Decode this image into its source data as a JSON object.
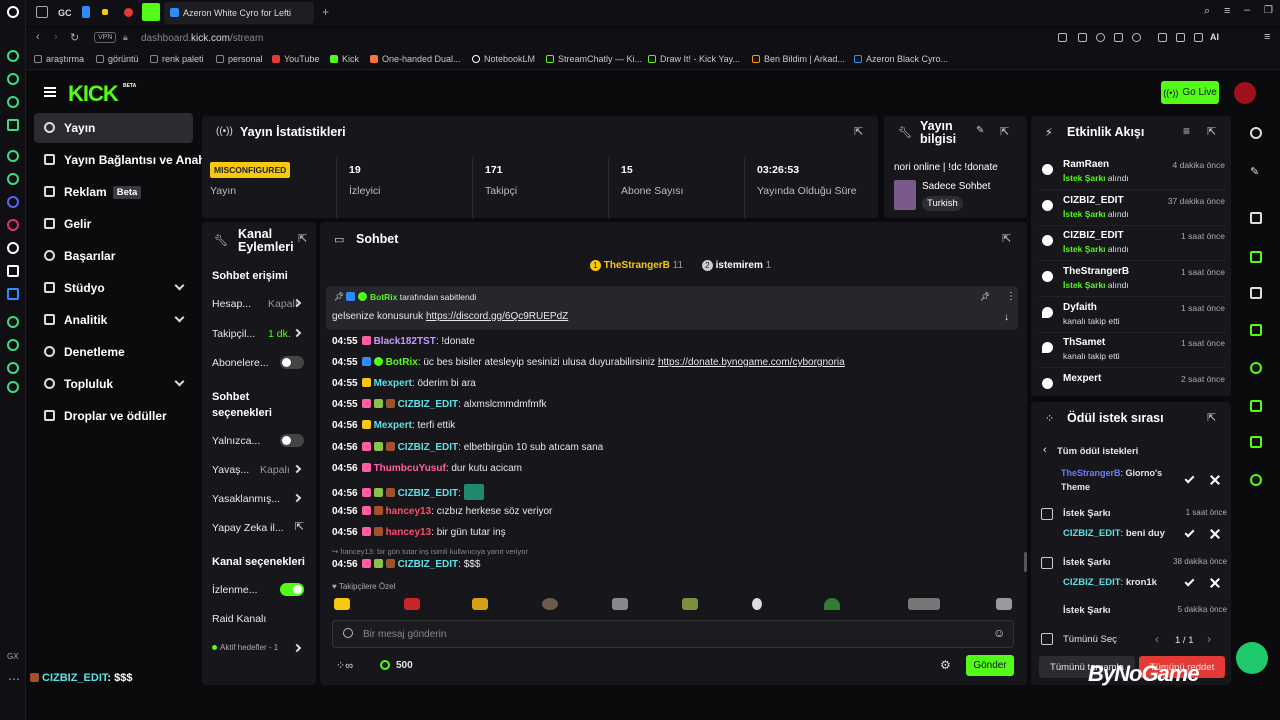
{
  "browser": {
    "tabs": [
      "GC"
    ],
    "active_tab": "Azeron White Cyro for Lefti",
    "url_prefix": "dashboard.",
    "url_host": "kick.com",
    "url_path": "/stream",
    "vpn": "VPN",
    "ai": "AI",
    "gx": "GX"
  },
  "bookmarks": [
    "araştırma",
    "görüntü",
    "renk paleti",
    "personal",
    "YouTube",
    "Kick",
    "One-handed Dual...",
    "NotebookLM",
    "StreamChatly — Ki...",
    "Draw It! - Kick Yay...",
    "Ben Bildim | Arkad...",
    "Azeron Black Cyro..."
  ],
  "header": {
    "logo": "KICK",
    "beta": "BETA",
    "go_live": "Go Live"
  },
  "sidebar": {
    "items": [
      {
        "label": "Yayın"
      },
      {
        "label": "Yayın Bağlantısı ve Anahtar"
      },
      {
        "label": "Reklam",
        "badge": "Beta"
      },
      {
        "label": "Gelir"
      },
      {
        "label": "Başarılar"
      },
      {
        "label": "Stüdyo"
      },
      {
        "label": "Analitik"
      },
      {
        "label": "Denetleme"
      },
      {
        "label": "Topluluk"
      },
      {
        "label": "Droplar ve ödüller"
      }
    ]
  },
  "stats": {
    "title": "Yayın İstatistikleri",
    "status": "MISCONFIGURED",
    "status_label": "Yayın",
    "items": [
      {
        "value": "19",
        "label": "İzleyici"
      },
      {
        "value": "171",
        "label": "Takipçi"
      },
      {
        "value": "15",
        "label": "Abone Sayısı"
      },
      {
        "value": "03:26:53",
        "label": "Yayında Olduğu Süre"
      }
    ]
  },
  "info": {
    "title_a": "Yayın",
    "title_b": "bilgisi",
    "stream_title": "nori online | !dc !donate",
    "category": "Sadece Sohbet",
    "language": "Turkish"
  },
  "channel": {
    "title_a": "Kanal",
    "title_b": "Eylemleri",
    "chat_access": "Sohbet erişimi",
    "rows1": [
      {
        "label": "Hesap...",
        "value": "Kapalı"
      },
      {
        "label": "Takipçil...",
        "value": "1 dk."
      },
      {
        "label": "Abonelere..."
      }
    ],
    "chat_opts_a": "Sohbet",
    "chat_opts_b": "seçenekleri",
    "rows2": [
      {
        "label": "Yalnızca..."
      },
      {
        "label": "Yavaş...",
        "value": "Kapalı"
      },
      {
        "label": "Yasaklanmış..."
      },
      {
        "label": "Yapay Zeka il..."
      }
    ],
    "channel_opts": "Kanal seçenekleri",
    "rows3": [
      {
        "label": "İzlenme..."
      },
      {
        "label": "Raid Kanalı"
      },
      {
        "label": "Aktif hedefler - 1"
      }
    ]
  },
  "chat": {
    "title": "Sohbet",
    "top": [
      {
        "rank": "1",
        "name": "TheStrangerB",
        "count": "11"
      },
      {
        "rank": "2",
        "name": "istemirem",
        "count": "1"
      }
    ],
    "pinned_by": "BotRix",
    "pinned_suffix": "tarafından sabitlendi",
    "pinned_text": "gelsenize konusuruk",
    "pinned_link": "https://discord.gg/6Qc9RUEPdZ",
    "messages": [
      {
        "time": "04:55",
        "user": "Black182TST",
        "text": "!donate",
        "color": "#c39bff"
      },
      {
        "time": "04:55",
        "user": "BotRix",
        "text": "üc bes bisiler atesleyip sesinizi ulusa duyurabilirsiniz",
        "link": "https://donate.bynogame.com/cyborgnoria",
        "color": "#53fc18"
      },
      {
        "time": "04:55",
        "user": "Mexpert",
        "text": "öderim bi ara",
        "color": "#5ce1e6"
      },
      {
        "time": "04:55",
        "user": "CIZBIZ_EDIT",
        "text": "alxmslcmmdmfmfk",
        "color": "#5ce1e6"
      },
      {
        "time": "04:56",
        "user": "Mexpert",
        "text": "terfi ettik",
        "color": "#5ce1e6"
      },
      {
        "time": "04:56",
        "user": "CIZBIZ_EDIT",
        "text": "elbetbirgün 10 sub atıcam sana",
        "color": "#5ce1e6"
      },
      {
        "time": "04:56",
        "user": "ThumbcuYusuf",
        "text": "dur kutu acicam",
        "color": "#ff5fa2"
      },
      {
        "time": "04:56",
        "user": "CIZBIZ_EDIT",
        "text": "",
        "color": "#5ce1e6"
      },
      {
        "time": "04:56",
        "user": "hancey13",
        "text": "cızbız herkese söz veriyor",
        "color": "#ff4d6d"
      },
      {
        "time": "04:56",
        "user": "hancey13",
        "text": "bir gün tutar inş",
        "color": "#ff4d6d"
      }
    ],
    "reply_hint": "hancey13: bir gün tutar inş isimli kullanıcıya yanıt veriyor",
    "last": {
      "time": "04:56",
      "user": "CIZBIZ_EDIT",
      "text": "$$$"
    },
    "followers_only": "Takipçilere Özel",
    "placeholder": "Bir mesaj gönderin",
    "points": "500",
    "send": "Gönder"
  },
  "events": {
    "title": "Etkinlik Akışı",
    "items": [
      {
        "name": "RamRaen",
        "sub_b": "İstek Şarkı",
        "sub": "alındı",
        "time": "4 dakika önce"
      },
      {
        "name": "CIZBIZ_EDIT",
        "sub_b": "İstek Şarkı",
        "sub": "alındı",
        "time": "37 dakika önce"
      },
      {
        "name": "CIZBIZ_EDIT",
        "sub_b": "İstek Şarkı",
        "sub": "alındı",
        "time": "1 saat önce"
      },
      {
        "name": "TheStrangerB",
        "sub_b": "İstek Şarkı",
        "sub": "alındı",
        "time": "1 saat önce"
      },
      {
        "name": "Dyfaith",
        "sub_b": "",
        "sub": "kanalı takip etti",
        "time": "1 saat önce"
      },
      {
        "name": "ThSamet",
        "sub_b": "",
        "sub": "kanalı takip etti",
        "time": "1 saat önce"
      },
      {
        "name": "Mexpert",
        "sub_b": "",
        "sub": "",
        "time": "2 saat önce"
      }
    ]
  },
  "rewards": {
    "title": "Ödül istek sırası",
    "all": "Tüm ödül istekleri",
    "first": {
      "user": "TheStrangerB",
      "text": "Giorno's",
      "text2": "Theme"
    },
    "items": [
      {
        "title": "İstek Şarkı",
        "time": "1 saat önce",
        "user": "CIZBIZ_EDIT",
        "text": "beni duy"
      },
      {
        "title": "İstek Şarkı",
        "time": "38 dakika önce",
        "user": "CIZBIZ_EDIT",
        "text": "kron1k"
      },
      {
        "title": "İstek Şarkı",
        "time": "5 dakika önce"
      }
    ],
    "select_all": "Tümünü Seç",
    "page": "1 / 1",
    "complete_all": "Tümünü tamamla",
    "reject_all": "Tümünü reddet"
  },
  "overlay": {
    "user": "CIZBIZ_EDIT",
    "text": ": $$$",
    "brand": "ByNoGame"
  }
}
